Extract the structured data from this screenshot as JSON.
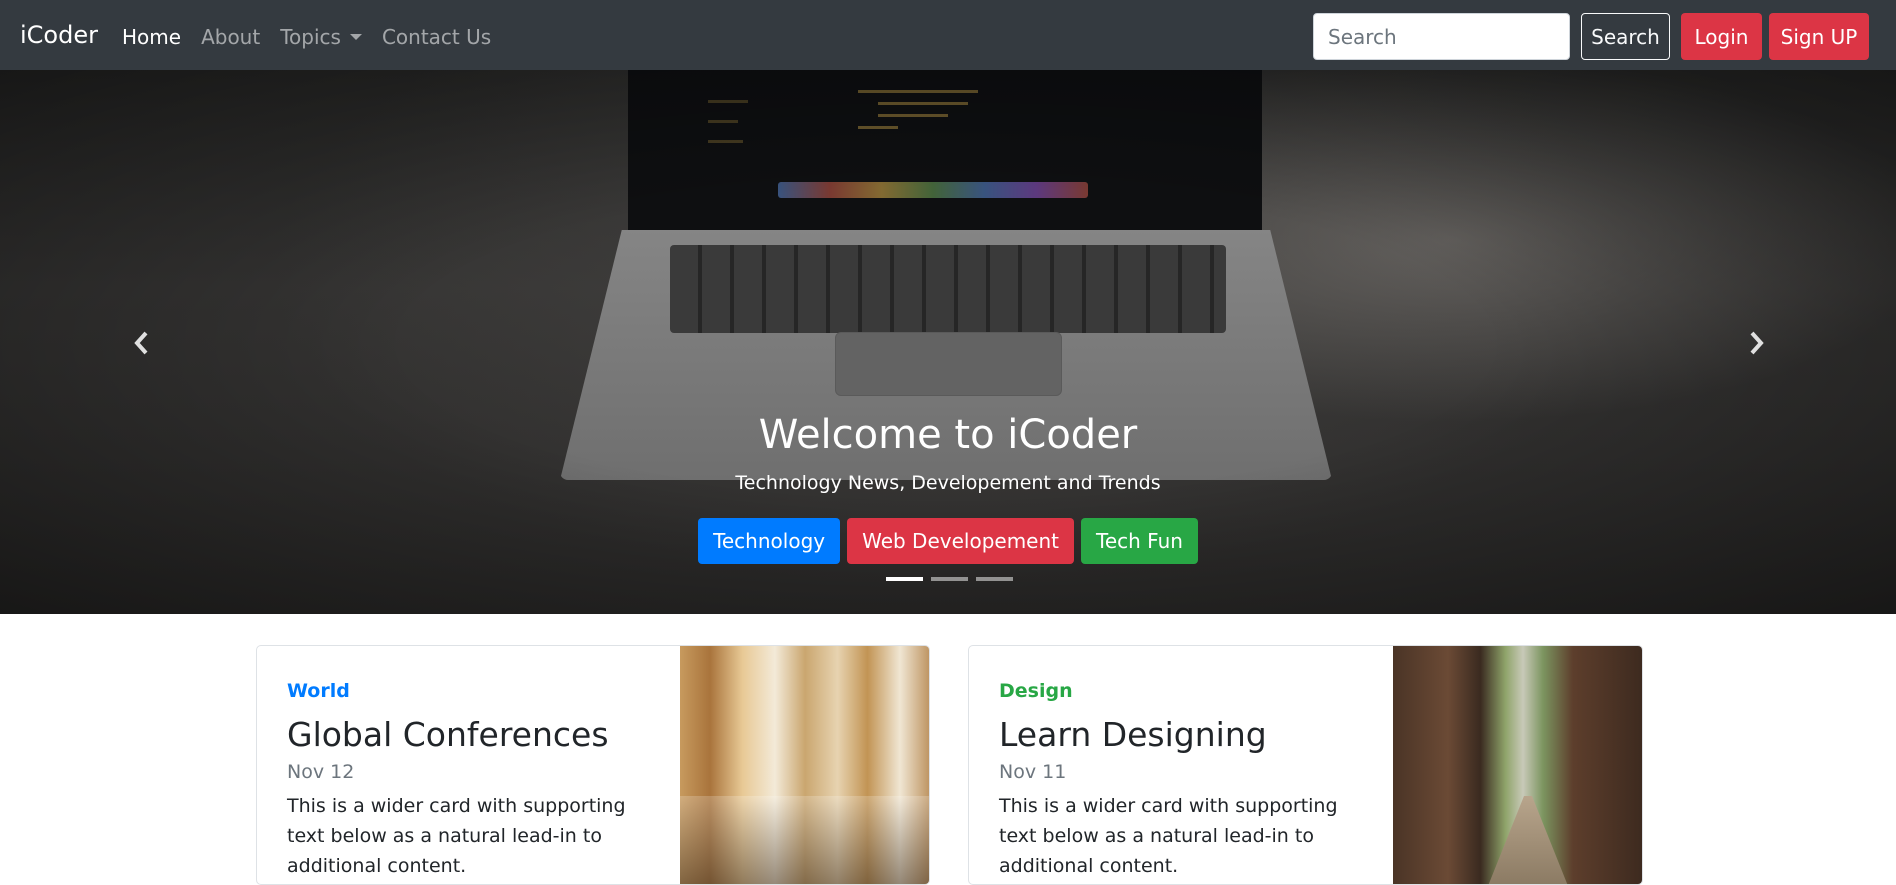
{
  "navbar": {
    "brand": "iCoder",
    "links": [
      {
        "label": "Home"
      },
      {
        "label": "About"
      },
      {
        "label": "Topics"
      },
      {
        "label": "Contact Us"
      }
    ],
    "search_placeholder": "Search",
    "search_button": "Search",
    "login_button": "Login",
    "signup_button": "Sign UP"
  },
  "carousel": {
    "title": "Welcome to iCoder",
    "subtitle": "Technology News, Developement and Trends",
    "buttons": [
      {
        "label": "Technology",
        "color": "#007bff"
      },
      {
        "label": "Web Developement",
        "color": "#dc3545"
      },
      {
        "label": "Tech Fun",
        "color": "#28a745"
      }
    ],
    "active_slide": 1,
    "slide_count": 3
  },
  "cards": [
    {
      "category": "World",
      "category_color": "#007bff",
      "title": "Global Conferences",
      "date": "Nov 12",
      "text": "This is a wider card with supporting text below as a natural lead-in to additional content."
    },
    {
      "category": "Design",
      "category_color": "#28a745",
      "title": "Learn Designing",
      "date": "Nov 11",
      "text": "This is a wider card with supporting text below as a natural lead-in to additional content."
    }
  ]
}
